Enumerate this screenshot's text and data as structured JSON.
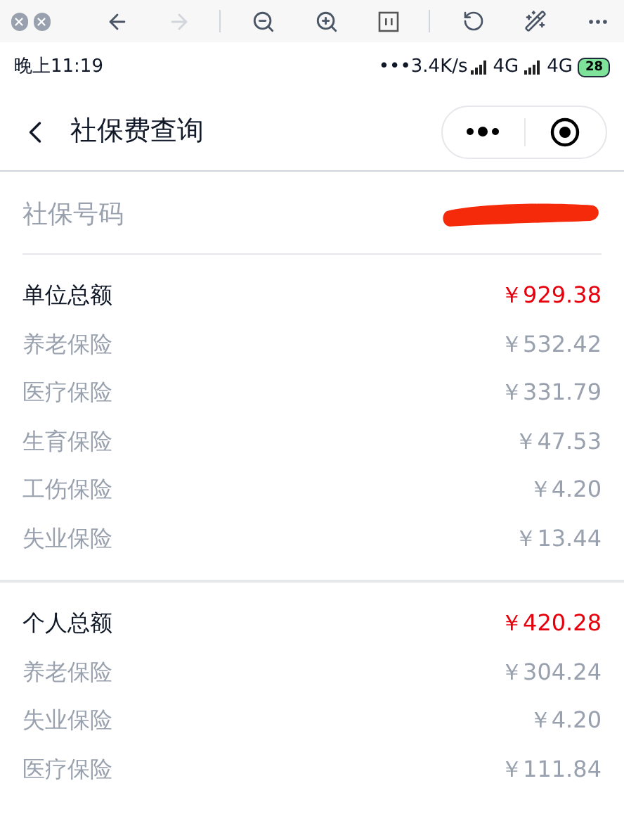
{
  "status_bar": {
    "time": "晚上11:19",
    "speed": "•••3.4K/s",
    "networks": [
      "4G",
      "4G"
    ],
    "battery": "28"
  },
  "nav": {
    "title": "社保费查询"
  },
  "id_row": {
    "label": "社保号码",
    "redacted": true
  },
  "sections": [
    {
      "total": {
        "label": "单位总额",
        "amount": "￥929.38"
      },
      "items": [
        {
          "label": "养老保险",
          "amount": "￥532.42"
        },
        {
          "label": "医疗保险",
          "amount": "￥331.79"
        },
        {
          "label": "生育保险",
          "amount": "￥47.53"
        },
        {
          "label": "工伤保险",
          "amount": "￥4.20"
        },
        {
          "label": "失业保险",
          "amount": "￥13.44"
        }
      ]
    },
    {
      "total": {
        "label": "个人总额",
        "amount": "￥420.28"
      },
      "items": [
        {
          "label": "养老保险",
          "amount": "￥304.24"
        },
        {
          "label": "失业保险",
          "amount": "￥4.20"
        },
        {
          "label": "医疗保险",
          "amount": "￥111.84"
        }
      ]
    }
  ]
}
